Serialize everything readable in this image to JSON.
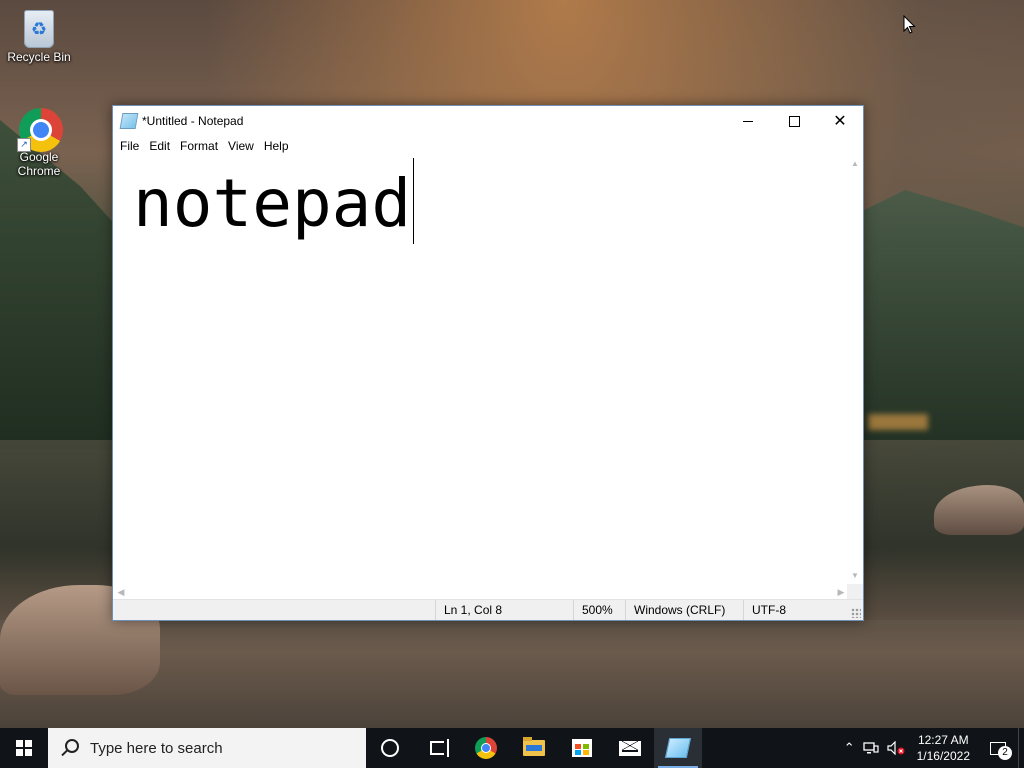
{
  "desktop": {
    "icons": [
      {
        "label": "Recycle Bin"
      },
      {
        "label": "Google Chrome"
      }
    ]
  },
  "window": {
    "title": "*Untitled - Notepad",
    "controls": {
      "minimize": "",
      "maximize": "",
      "close": "✕"
    },
    "menu": [
      "File",
      "Edit",
      "Format",
      "View",
      "Help"
    ],
    "editor_text": "notepad",
    "status": {
      "position": "Ln 1, Col 8",
      "zoom": "500%",
      "line_ending": "Windows (CRLF)",
      "encoding": "UTF-8"
    }
  },
  "taskbar": {
    "search_placeholder": "Type here to search",
    "pinned": [
      "cortana-icon",
      "task-view-icon",
      "chrome-icon",
      "file-explorer-icon",
      "store-icon",
      "mail-icon",
      "notepad-icon"
    ],
    "tray": {
      "chevron": "⌃",
      "time": "12:27 AM",
      "date": "1/16/2022",
      "notification_count": "2"
    }
  },
  "colors": {
    "taskbar": "#101418",
    "window_border": "#6f8fb8",
    "status_bar": "#f0f0f0"
  }
}
